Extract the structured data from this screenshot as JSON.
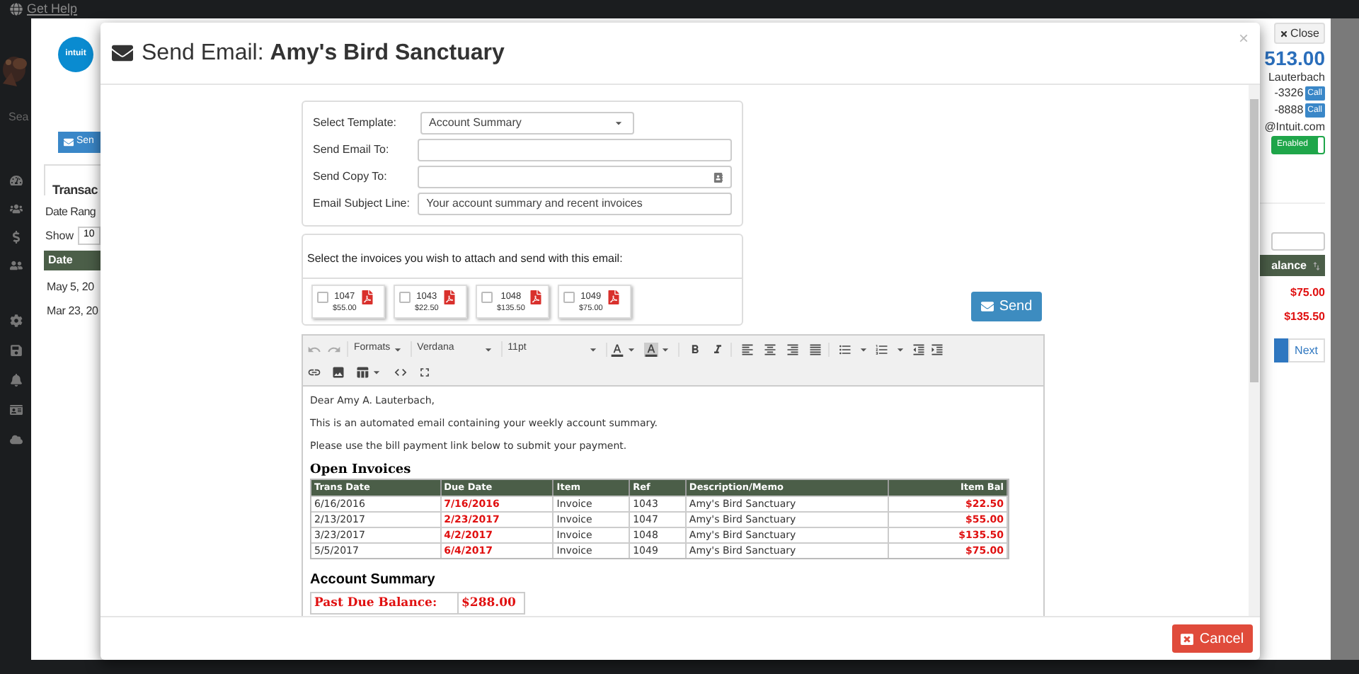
{
  "top_bar": {
    "help_link": "Get Help"
  },
  "sidebar": {
    "search_label": "Sea"
  },
  "background_left": {
    "logo": "intuit",
    "send_button": "Sen",
    "tab": "Transac",
    "date_range_label": "Date Rang",
    "show_label": "Show",
    "show_value": "10",
    "table_header": "Date",
    "rows": [
      "May 5, 20",
      "Mar 23, 20"
    ]
  },
  "background_right": {
    "close_button": "Close",
    "balance": "513.00",
    "contact_name": "Lauterbach",
    "phones": [
      {
        "number": "-3326",
        "call": "Call"
      },
      {
        "number": "-8888",
        "call": "Call"
      }
    ],
    "email": "@Intuit.com",
    "autopay": {
      "label": "Enabled",
      "on": true
    },
    "table_header": "alance",
    "amounts": [
      "$75.00",
      "$135.50"
    ],
    "pagination": [
      {
        "selected": true
      },
      {
        "label": "Next",
        "selected": false
      }
    ]
  },
  "modal": {
    "title": "Send Email: **Amy's Bird Sanctuary**",
    "close": "×",
    "form": {
      "fields": [
        {
          "label": "Select Template:",
          "kind": "select",
          "value": "Account Summary"
        },
        {
          "label": "Send Email To:",
          "kind": "text"
        },
        {
          "label": "Send Copy To:",
          "kind": "contacts"
        },
        {
          "label": "Email Subject Line:",
          "kind": "text",
          "value": "Your account summary and recent invoices"
        }
      ]
    },
    "invoices": {
      "prompt": "Select the invoices you wish to attach and send with this email:",
      "items": [
        {
          "number": "1047",
          "amount": "$55.00",
          "checked": false
        },
        {
          "number": "1043",
          "amount": "$22.50",
          "checked": false
        },
        {
          "number": "1048",
          "amount": "$135.50",
          "checked": false
        },
        {
          "number": "1049",
          "amount": "$75.00",
          "checked": false
        }
      ]
    },
    "send_button": "Send",
    "editor": {
      "toolbar": {
        "formats": "Formats",
        "font": "Verdana",
        "size": "11pt"
      },
      "body": {
        "paragraphs": [
          "Dear Amy A. Lauterbach,",
          "This is an automated email containing your weekly account summary.",
          "Please use the bill payment link below to submit your payment."
        ],
        "invoices_heading": "Open Invoices",
        "table": {
          "columns": [
            "Trans Date",
            "Due Date",
            "Item",
            "Ref",
            "Description/Memo",
            "Item Bal"
          ],
          "rows": [
            [
              "6/16/2016",
              "7/16/2016",
              "Invoice",
              "1043",
              "Amy's Bird Sanctuary",
              "$22.50"
            ],
            [
              "2/13/2017",
              "2/23/2017",
              "Invoice",
              "1047",
              "Amy's Bird Sanctuary",
              "$55.00"
            ],
            [
              "3/23/2017",
              "4/2/2017",
              "Invoice",
              "1048",
              "Amy's Bird Sanctuary",
              "$135.50"
            ],
            [
              "5/5/2017",
              "6/4/2017",
              "Invoice",
              "1049",
              "Amy's Bird Sanctuary",
              "$75.00"
            ]
          ]
        },
        "summary_heading": "Account Summary",
        "summary_rows": [
          {
            "label": "Past Due Balance:",
            "value": "$288.00"
          }
        ]
      }
    },
    "cancel_button": "Cancel"
  }
}
